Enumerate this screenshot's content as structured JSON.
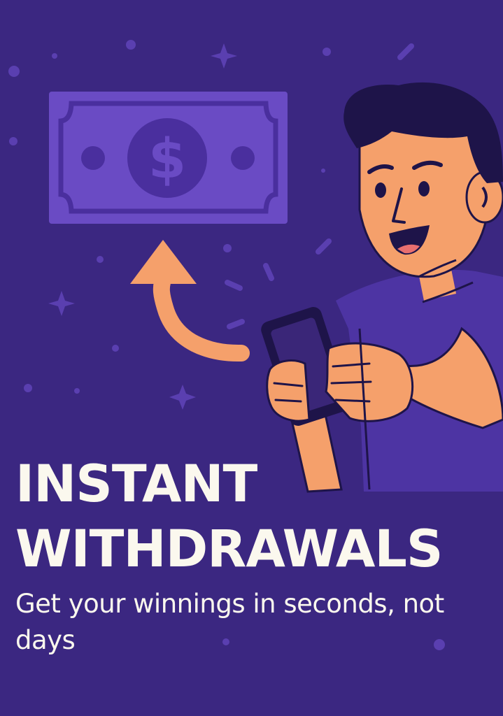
{
  "headline": {
    "line1": "INSTANT",
    "line2": "WITHDRAWALS"
  },
  "subheadline": "Get your winnings in seconds, not days",
  "illustration": {
    "banknote_symbol": "$",
    "icons": [
      "banknote-icon",
      "up-arrow-icon",
      "sparkle-icon",
      "smartphone-icon"
    ]
  },
  "colors": {
    "background": "#3b2781",
    "banknote": "#6a4bc4",
    "accent_orange": "#f5a06b",
    "text": "#fbf8ee",
    "ink": "#1e1449"
  }
}
